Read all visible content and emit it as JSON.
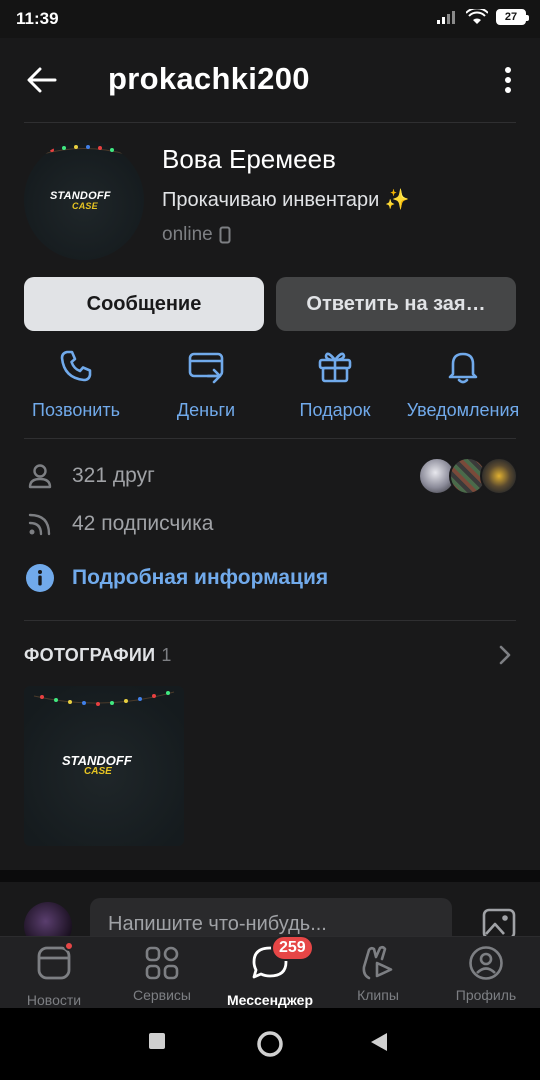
{
  "status_bar": {
    "time": "11:39",
    "battery": "27"
  },
  "header": {
    "title": "prokachki200"
  },
  "profile": {
    "name": "Вова Еремеев",
    "status": "Прокачиваю инвентари ✨",
    "online": "online",
    "avatar_logo": "STANDOFF",
    "avatar_logo_sub": "CASE"
  },
  "buttons": {
    "message": "Сообщение",
    "reply": "Ответить на зая…"
  },
  "actions": [
    {
      "label": "Позвонить",
      "icon": "phone-icon"
    },
    {
      "label": "Деньги",
      "icon": "money-icon"
    },
    {
      "label": "Подарок",
      "icon": "gift-icon"
    },
    {
      "label": "Уведомления",
      "icon": "bell-icon"
    }
  ],
  "info": {
    "friends": "321 друг",
    "followers": "42 подписчика",
    "details_link": "Подробная информация"
  },
  "photos": {
    "title": "ФОТОГРАФИИ",
    "count": "1"
  },
  "post": {
    "placeholder": "Напишите что-нибудь..."
  },
  "tabs": [
    {
      "label": "Новости",
      "icon": "news-icon",
      "dot": true
    },
    {
      "label": "Сервисы",
      "icon": "services-icon"
    },
    {
      "label": "Мессенджер",
      "icon": "messenger-icon",
      "badge": "259",
      "active": true
    },
    {
      "label": "Клипы",
      "icon": "clips-icon"
    },
    {
      "label": "Профиль",
      "icon": "profile-icon"
    }
  ],
  "colors": {
    "accent": "#71aaeb",
    "background": "#19191a",
    "badge": "#e64646"
  }
}
